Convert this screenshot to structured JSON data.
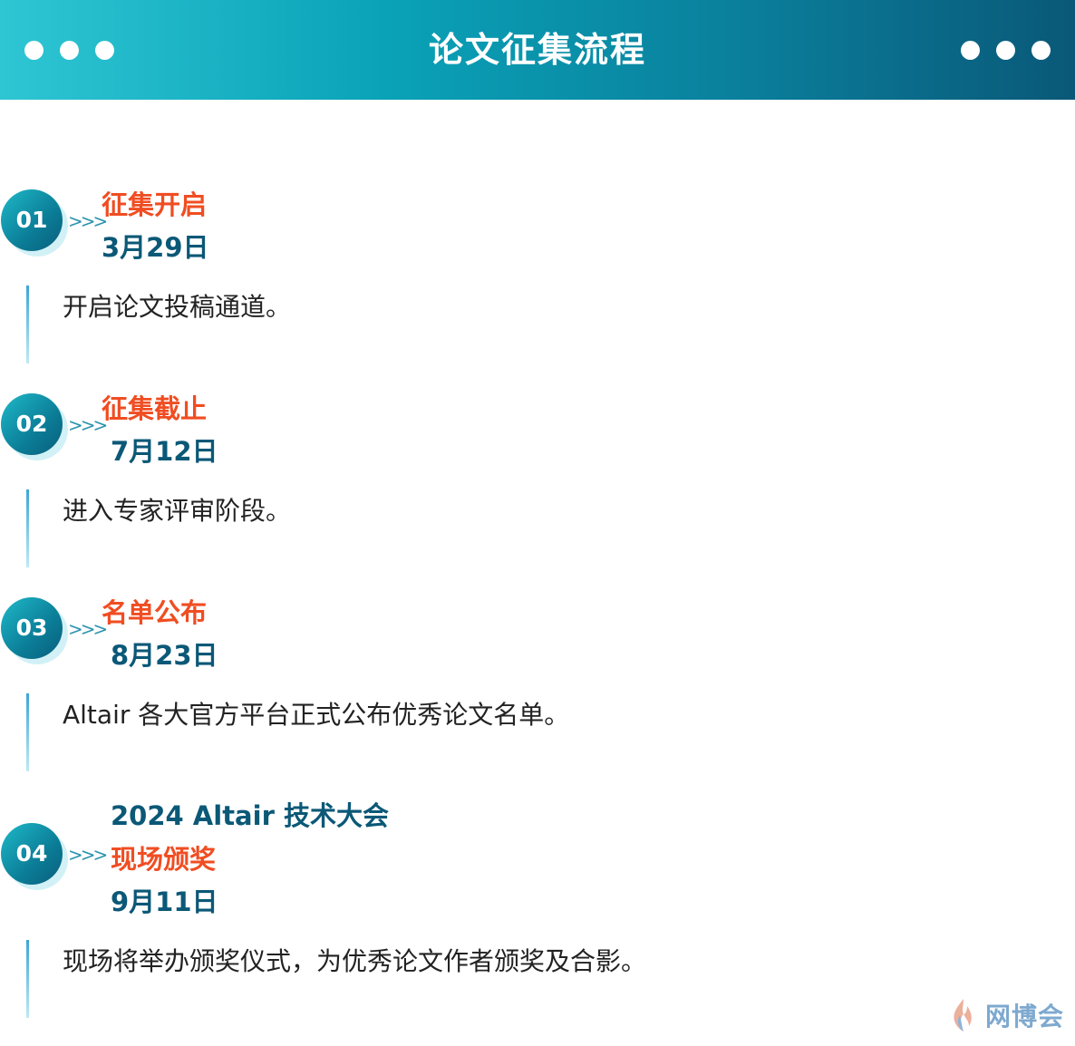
{
  "header": {
    "title": "论文征集流程"
  },
  "steps": [
    {
      "number": "01",
      "title": "征集开启",
      "date": "3月29日",
      "description": "开启论文投稿通道。"
    },
    {
      "number": "02",
      "title": "征集截止",
      "date": "7月12日",
      "description": "进入专家评审阶段。"
    },
    {
      "number": "03",
      "title": "名单公布",
      "date": "8月23日",
      "description": "Altair 各大官方平台正式公布优秀论文名单。"
    },
    {
      "number": "04",
      "event": "2024 Altair 技术大会",
      "title": "现场颁奖",
      "date": "9月11日",
      "description": "现场将举办颁奖仪式，为优秀论文作者颁奖及合影。"
    }
  ],
  "watermark": {
    "text": "网博会"
  },
  "colors": {
    "accent_orange": "#f04d22",
    "accent_blue": "#0b5877",
    "header_start": "#2ec6d3",
    "header_end": "#0a5878"
  },
  "icons": {
    "header_left": "dots-icon",
    "header_right": "dots-icon",
    "step_arrow": "chevrons-right-icon",
    "watermark": "flame-logo-icon"
  }
}
